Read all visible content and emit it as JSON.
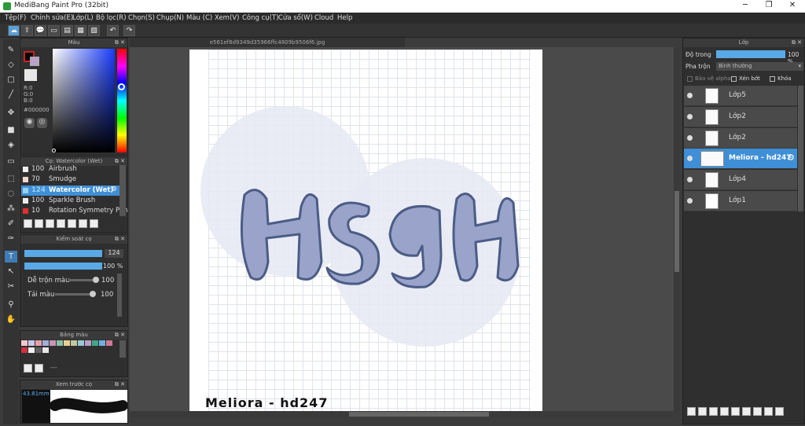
{
  "app": {
    "title": "MediBang Paint Pro (32bit)"
  },
  "menu": [
    "Tệp(F)",
    "Chỉnh sửa(E)",
    "Lớp(L)",
    "Bộ lọc(R)",
    "Chọn(S)",
    "Chụp(N)",
    "Màu (C)",
    "Xem(V)",
    "Công cụ(T)",
    "Cửa sổ(W)",
    "Cloud",
    "Help"
  ],
  "color_panel": {
    "title": "Màu",
    "r": "R:0",
    "g": "G:0",
    "b": "B:0",
    "hex": "#000000"
  },
  "brush_panel": {
    "title": "Cọ: Watercolor (Wet)",
    "items": [
      {
        "size": "100",
        "name": "Airbrush",
        "swatch": "#eeeeee"
      },
      {
        "size": "70",
        "name": "Smudge",
        "swatch": "#f0d8d0"
      },
      {
        "size": "124",
        "name": "Watercolor (Wet)",
        "swatch": "#9ad0f0"
      },
      {
        "size": "100",
        "name": "Sparkle Brush",
        "swatch": "#e8e8e8"
      },
      {
        "size": "10",
        "name": "Rotation Symmetry Pen",
        "swatch": "#e03030"
      }
    ]
  },
  "brush_control": {
    "title": "Kiểm soát cọ",
    "size_value": "124",
    "opacity_value": "100 %",
    "blend_label": "Dễ trộn màu",
    "blend_value": "100",
    "reload_label": "Tải màu",
    "reload_value": "100"
  },
  "palette": {
    "title": "Bảng màu",
    "dash": "---"
  },
  "navigator": {
    "title": "Xem trước cọ",
    "size": "43.81mm"
  },
  "document": {
    "filename": "e561ef8d9349d35966ffc4809b9506f6.jpg",
    "signature": "Meliora - hd247",
    "big_text": "HSGH"
  },
  "layer_panel": {
    "title": "Lớp",
    "opacity_label": "Độ trong",
    "opacity_value": "100 %",
    "blend_label": "Pha trộn",
    "blend_value": "Bình thường",
    "protect_alpha": "Bảo vệ alpha",
    "clipping": "Xén bớt",
    "lock": "Khóa",
    "layers": [
      {
        "name": "Lớp5",
        "selected": false
      },
      {
        "name": "Lớp2",
        "selected": false
      },
      {
        "name": "Lớp2",
        "selected": false
      },
      {
        "name": "Meliora - hd247",
        "selected": true
      },
      {
        "name": "Lớp4",
        "selected": false
      },
      {
        "name": "Lớp1",
        "selected": false
      }
    ]
  },
  "colors": {
    "accent": "#3f8fd6",
    "lettering": "#9aa3c9",
    "outline": "#4b5c86",
    "circle": "#e6e9f3"
  }
}
